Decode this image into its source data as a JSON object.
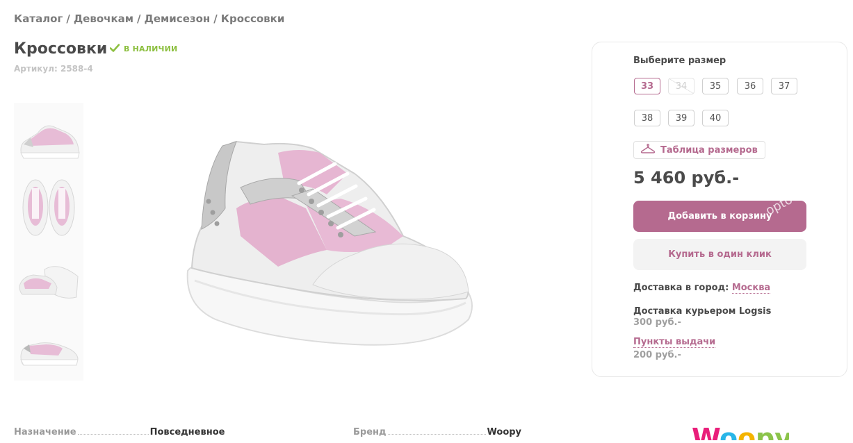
{
  "breadcrumb": {
    "items": [
      "Каталог",
      "Девочкам",
      "Демисезон",
      "Кроссовки"
    ],
    "separator": "/"
  },
  "product": {
    "title": "Кроссовки",
    "stock_status": "В НАЛИЧИИ",
    "sku": "Артикул: 2588-4"
  },
  "sizes": {
    "title": "Выберите размер",
    "items": [
      {
        "label": "33",
        "state": "selected"
      },
      {
        "label": "34",
        "state": "unavailable"
      },
      {
        "label": "35",
        "state": "available"
      },
      {
        "label": "36",
        "state": "available"
      },
      {
        "label": "37",
        "state": "available"
      },
      {
        "label": "38",
        "state": "available"
      },
      {
        "label": "39",
        "state": "available"
      },
      {
        "label": "40",
        "state": "available"
      }
    ],
    "table_label": "Таблица размеров"
  },
  "price": "5 460 руб.-",
  "buttons": {
    "add_to_cart": "Добавить в корзину",
    "one_click": "Купить в один клик"
  },
  "delivery": {
    "city_label": "Доставка в город:",
    "city": "Москва",
    "courier_label": "Доставка курьером Logsis",
    "courier_price": "300 руб.-",
    "pickup_label": "Пункты выдачи",
    "pickup_price": "200 руб.-"
  },
  "watermark": "optova",
  "specs": [
    {
      "key": "Назначение",
      "value": "Повседневное"
    },
    {
      "key": "Бренд",
      "value": "Woopy"
    }
  ],
  "brand_logo_text": "Woopy",
  "colors": {
    "accent": "#b56a8f",
    "in_stock": "#8cbf3f",
    "text_dark": "#4a4a4a",
    "text_muted": "#a0a0a0"
  },
  "icons": {
    "stock": "check-icon",
    "size_table": "hanger-icon"
  }
}
